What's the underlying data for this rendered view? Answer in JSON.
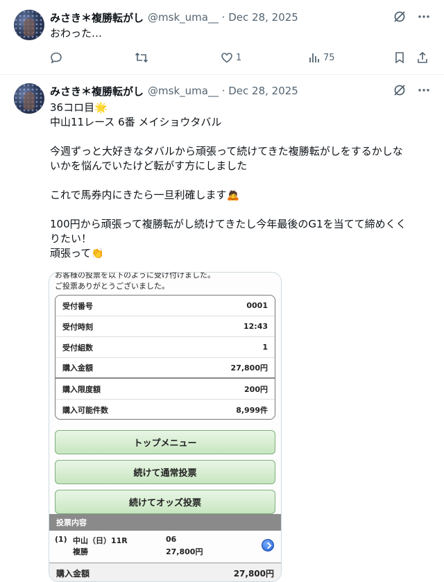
{
  "tweets": [
    {
      "name": "みさき＊複勝転がし",
      "handle": "@msk_uma__ · Dec 28, 2025",
      "text": [
        "おわった…"
      ],
      "replies": "",
      "reposts": "",
      "likes": "1",
      "views": "75"
    },
    {
      "name": "みさき＊複勝転がし",
      "handle": "@msk_uma__ · Dec 28, 2025",
      "text": [
        "36コロ目🌟",
        "中山11レース 6番 メイショウタバル",
        "",
        "今週ずっと大好きなタバルから頑張って続けてきた複勝転がしをするかしな",
        "いかを悩んでいたけど転がす方にしました",
        "",
        "これで馬券内にきたら一旦利確します🙇",
        "",
        "100円から頑張って複勝転がし続けてきたし今年最後のG1を当てて締めくく",
        "りたい！",
        "頑張って👏"
      ]
    }
  ],
  "receipt": {
    "top_lines": [
      "お客様の投票を以下のように受け付けました。",
      "ご投票ありがとうございました。"
    ],
    "rows": [
      {
        "label": "受付番号",
        "value": "0001"
      },
      {
        "label": "受付時刻",
        "value": "12:43"
      },
      {
        "label": "受付組数",
        "value": "1"
      },
      {
        "label": "購入金額",
        "value": "27,800円"
      },
      {
        "label": "購入限度額",
        "value": "200円"
      },
      {
        "label": "購入可能件数",
        "value": "8,999件"
      }
    ],
    "buttons": [
      "トップメニュー",
      "続けて通常投票",
      "続けてオッズ投票"
    ],
    "section_title": "投票内容",
    "bet": {
      "index": "(1)",
      "race": "中山（日）11R",
      "horse": "06",
      "type": "複勝",
      "amount": "27,800円"
    },
    "total_label": "購入金額",
    "total_value": "27,800円"
  }
}
